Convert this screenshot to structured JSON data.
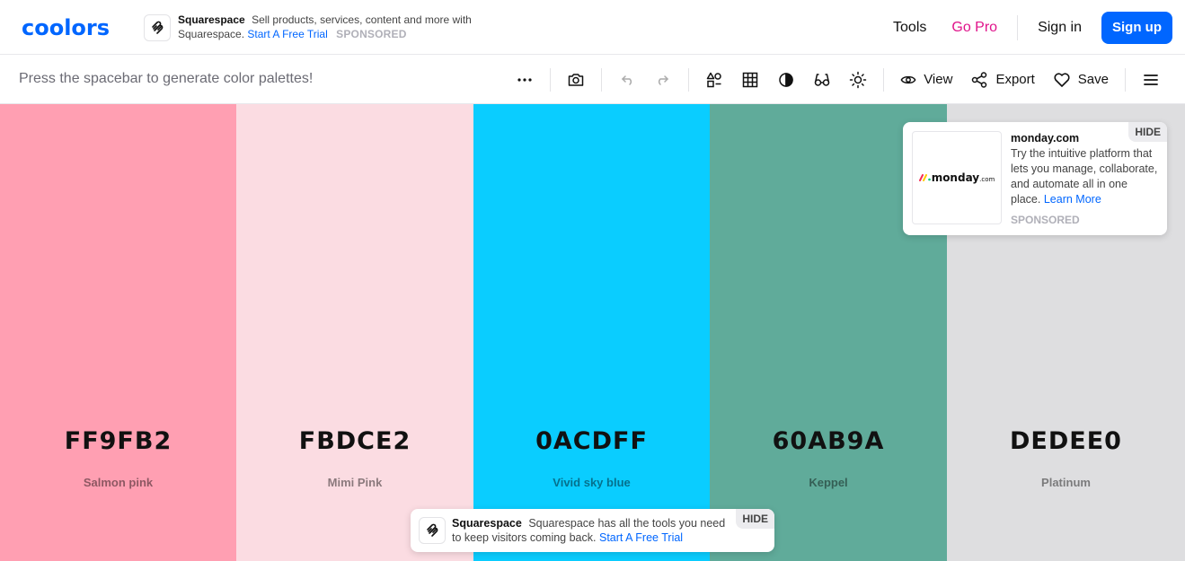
{
  "app": {
    "logo": "coolors"
  },
  "top_ad": {
    "brand": "Squarespace",
    "text": "Sell products, services, content and more with Squarespace.",
    "cta": "Start A Free Trial",
    "sponsored": "SPONSORED"
  },
  "nav": {
    "tools": "Tools",
    "go_pro": "Go Pro",
    "sign_in": "Sign in",
    "sign_up": "Sign up"
  },
  "toolbar": {
    "hint": "Press the spacebar to generate color palettes!",
    "view": "View",
    "export": "Export",
    "save": "Save"
  },
  "palette": [
    {
      "hex": "FF9FB2",
      "name": "Salmon pink",
      "color": "#FF9FB2"
    },
    {
      "hex": "FBDCE2",
      "name": "Mimi Pink",
      "color": "#FBDCE2"
    },
    {
      "hex": "0ACDFF",
      "name": "Vivid sky blue",
      "color": "#0ACDFF"
    },
    {
      "hex": "60AB9A",
      "name": "Keppel",
      "color": "#60AB9A"
    },
    {
      "hex": "DEDEE0",
      "name": "Platinum",
      "color": "#DEDEE0"
    }
  ],
  "side_ad": {
    "logo_text": "monday",
    "logo_suffix": ".com",
    "brand": "monday.com",
    "text": "Try the intuitive platform that lets you manage, collaborate, and automate all in one place.",
    "cta": "Learn More",
    "sponsored": "SPONSORED",
    "hide": "HIDE"
  },
  "bottom_ad": {
    "brand": "Squarespace",
    "text": "Squarespace has all the tools you need to keep visitors coming back.",
    "cta": "Start A Free Trial",
    "hide": "HIDE"
  },
  "colors": {
    "accent": "#0066ff",
    "pro": "#e0148b"
  }
}
